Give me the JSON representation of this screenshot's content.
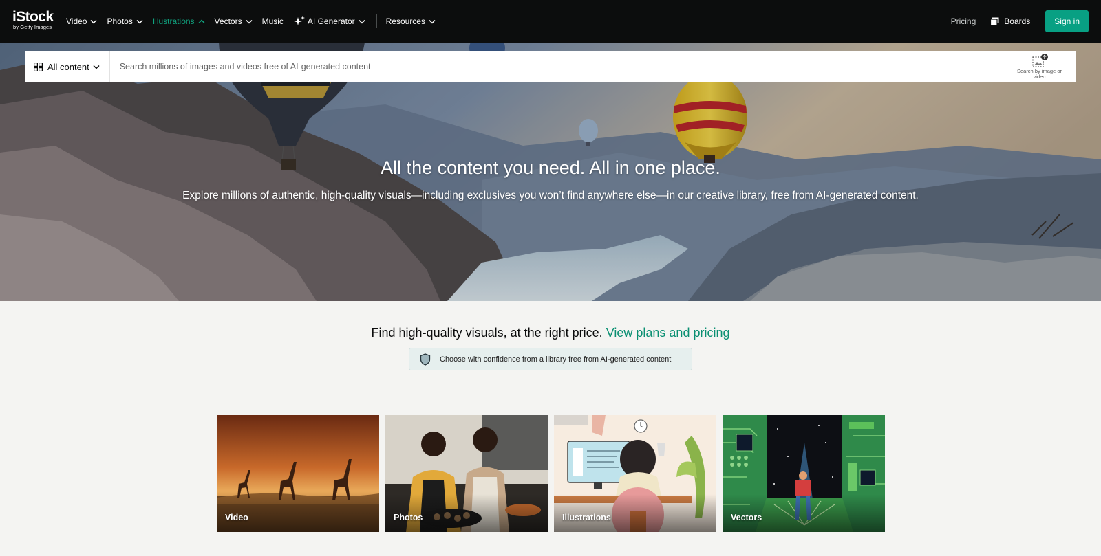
{
  "header": {
    "logo": {
      "main": "iStock",
      "sub": "by Getty Images"
    },
    "nav": [
      {
        "label": "Video",
        "dropdown": true,
        "active": false
      },
      {
        "label": "Photos",
        "dropdown": true,
        "active": false
      },
      {
        "label": "Illustrations",
        "dropdown": true,
        "active": true
      },
      {
        "label": "Vectors",
        "dropdown": true,
        "active": false
      },
      {
        "label": "Music",
        "dropdown": false,
        "active": false
      },
      {
        "label": "AI Generator",
        "dropdown": true,
        "active": false,
        "icon": "sparkle-icon"
      },
      {
        "label": "Resources",
        "dropdown": true,
        "active": false
      }
    ],
    "pricing": "Pricing",
    "boards": "Boards",
    "sign_in": "Sign in"
  },
  "search": {
    "filter_label": "All content",
    "placeholder": "Search millions of images and videos free of AI-generated content",
    "visual_search_label": "Search by image or video"
  },
  "hero": {
    "title": "All the content you need. All in one place.",
    "subtitle": "Explore millions of authentic, high-quality visuals—including exclusives you won’t find anywhere else—in our creative library, free from AI-generated content."
  },
  "pricing_section": {
    "text": "Find high-quality visuals, at the right price.",
    "link": "View plans and pricing",
    "confidence": "Choose with confidence from a library free from AI-generated content"
  },
  "tiles": [
    {
      "label": "Video"
    },
    {
      "label": "Photos"
    },
    {
      "label": "Illustrations"
    },
    {
      "label": "Vectors"
    }
  ],
  "colors": {
    "header_bg": "#0c0d0d",
    "accent": "#08a083",
    "link": "#0a8f72",
    "page_bg": "#f4f4f2"
  }
}
